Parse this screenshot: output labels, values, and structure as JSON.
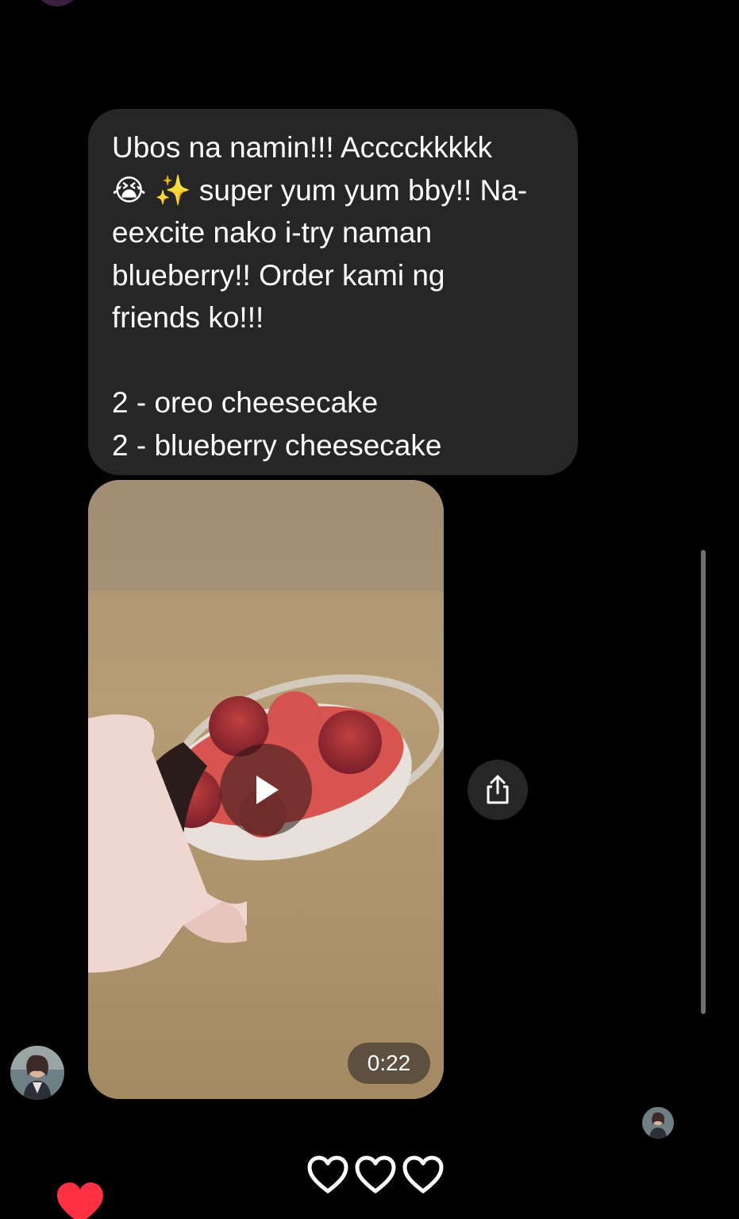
{
  "message": {
    "text": "Ubos na namin!!! Acccckkkkk\n😭 ✨ super yum yum bby!! Na-\neexcite nako i-try naman\nblueberry!! Order kami ng\nfriends ko!!!\n\n2 - oreo cheesecake\n2 - blueberry cheesecake"
  },
  "video": {
    "duration": "0:22",
    "play_icon": "play-icon"
  },
  "share": {
    "icon": "share-icon"
  },
  "reactions": {
    "hearts": [
      "heart-outline-icon",
      "heart-outline-icon",
      "heart-outline-icon"
    ],
    "liked_icon": "heart-filled-icon"
  },
  "colors": {
    "background": "#000000",
    "bubble": "#262626",
    "heart_red": "#ff3040",
    "scrollbar": "#6e6e6e"
  }
}
